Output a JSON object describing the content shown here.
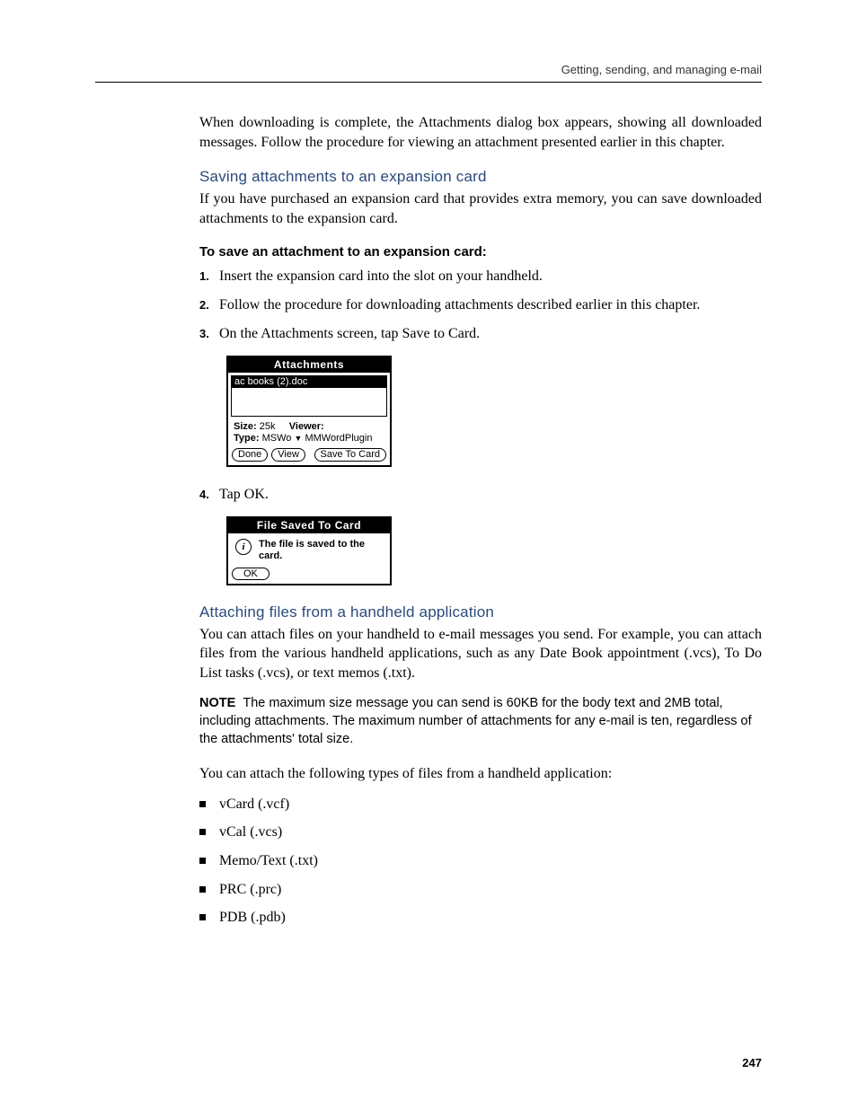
{
  "header": {
    "running": "Getting, sending, and managing e-mail"
  },
  "intro": "When downloading is complete, the Attachments dialog box appears, showing all downloaded messages. Follow the procedure for viewing an attachment presented earlier in this chapter.",
  "section1": {
    "title": "Saving attachments to an expansion card",
    "body": "If you have purchased an expansion card that provides extra memory, you can save downloaded attachments to the expansion card.",
    "task_title": "To save an attachment to an expansion card:",
    "steps": [
      "Insert the expansion card into the slot on your handheld.",
      "Follow the procedure for downloading attachments described earlier in this chapter.",
      "On the Attachments screen, tap Save to Card.",
      "Tap OK."
    ]
  },
  "dialog1": {
    "title": "Attachments",
    "file": "ac books (2).doc",
    "size_label": "Size:",
    "size_value": "25k",
    "viewer_label": "Viewer:",
    "type_label": "Type:",
    "type_value": "MSWo",
    "type_dropdown_value": "MMWordPlugin",
    "btn_done": "Done",
    "btn_view": "View",
    "btn_save": "Save To Card"
  },
  "dialog2": {
    "title": "File Saved To Card",
    "message": "The file is saved to the card.",
    "btn_ok": "OK"
  },
  "section2": {
    "title": "Attaching files from a handheld application",
    "body": "You can attach files on your handheld to e-mail messages you send. For example, you can attach files from the various handheld applications, such as any Date Book appointment (.vcs), To Do List tasks (.vcs), or text memos (.txt).",
    "note_label": "NOTE",
    "note_body": "The maximum size message you can send is 60KB for the body text and 2MB total, including attachments. The maximum number of attachments for any e-mail is ten, regardless of the attachments' total size.",
    "body2": "You can attach the following types of files from a handheld application:",
    "filetypes": [
      "vCard (.vcf)",
      "vCal (.vcs)",
      "Memo/Text (.txt)",
      "PRC (.prc)",
      "PDB (.pdb)"
    ]
  },
  "page_number": "247"
}
